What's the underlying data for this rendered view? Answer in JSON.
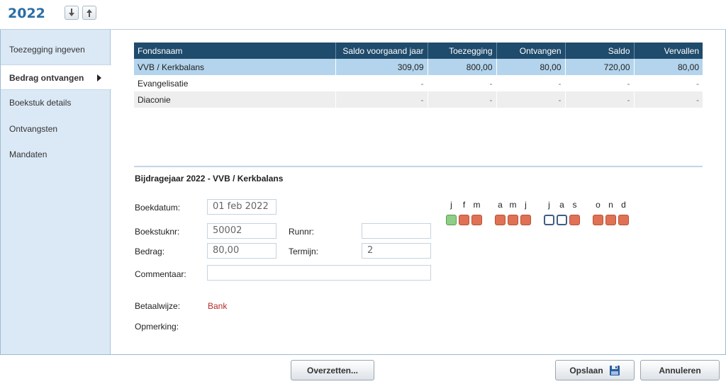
{
  "header": {
    "year": "2022",
    "icons": {
      "down": "arrow-down-icon",
      "up": "arrow-up-icon"
    }
  },
  "sidebar": {
    "items": [
      {
        "label": "Toezegging ingeven"
      },
      {
        "label": "Bedrag ontvangen"
      },
      {
        "label": "Boekstuk details"
      },
      {
        "label": "Ontvangsten"
      },
      {
        "label": "Mandaten"
      }
    ],
    "active_index": 1
  },
  "table": {
    "columns": [
      "Fondsnaam",
      "Saldo voorgaand jaar",
      "Toezegging",
      "Ontvangen",
      "Saldo",
      "Vervallen"
    ],
    "rows": [
      [
        "VVB / Kerkbalans",
        "309,09",
        "800,00",
        "80,00",
        "720,00",
        "80,00"
      ],
      [
        "Evangelisatie",
        "-",
        "-",
        "-",
        "-",
        "-"
      ],
      [
        "Diaconie",
        "-",
        "-",
        "-",
        "-",
        "-"
      ]
    ]
  },
  "form": {
    "title": "Bijdragejaar 2022 - VVB / Kerkbalans",
    "boekdatum_label": "Boekdatum:",
    "boekdatum_value": "01 feb 2022",
    "boekstuknr_label": "Boekstuknr:",
    "boekstuknr_value": "50002",
    "runnr_label": "Runnr:",
    "runnr_value": "",
    "bedrag_label": "Bedrag:",
    "bedrag_value": "80,00",
    "termijn_label": "Termijn:",
    "termijn_value": "2",
    "commentaar_label": "Commentaar:",
    "commentaar_value": "",
    "betaalwijze_label": "Betaalwijze:",
    "betaalwijze_value": "Bank",
    "opmerking_label": "Opmerking:"
  },
  "months": {
    "letters": [
      "j",
      "f",
      "m",
      "a",
      "m",
      "j",
      "j",
      "a",
      "s",
      "o",
      "n",
      "d"
    ],
    "status": [
      "paid",
      "open",
      "open",
      "open",
      "open",
      "open",
      "none",
      "none",
      "open",
      "open",
      "open",
      "open"
    ],
    "colors": {
      "paid": "#8fce85",
      "open": "#e07155",
      "none": "#ffffff"
    }
  },
  "buttons": {
    "overzetten": "Overzetten...",
    "opslaan": "Opslaan",
    "annuleren": "Annuleren"
  },
  "colors": {
    "accent": "#2a6ea6",
    "table_header": "#1f4b6c",
    "selected_row": "#b3d4ec",
    "sidebar": "#dbe9f6",
    "bank_text": "#b72b2b"
  }
}
